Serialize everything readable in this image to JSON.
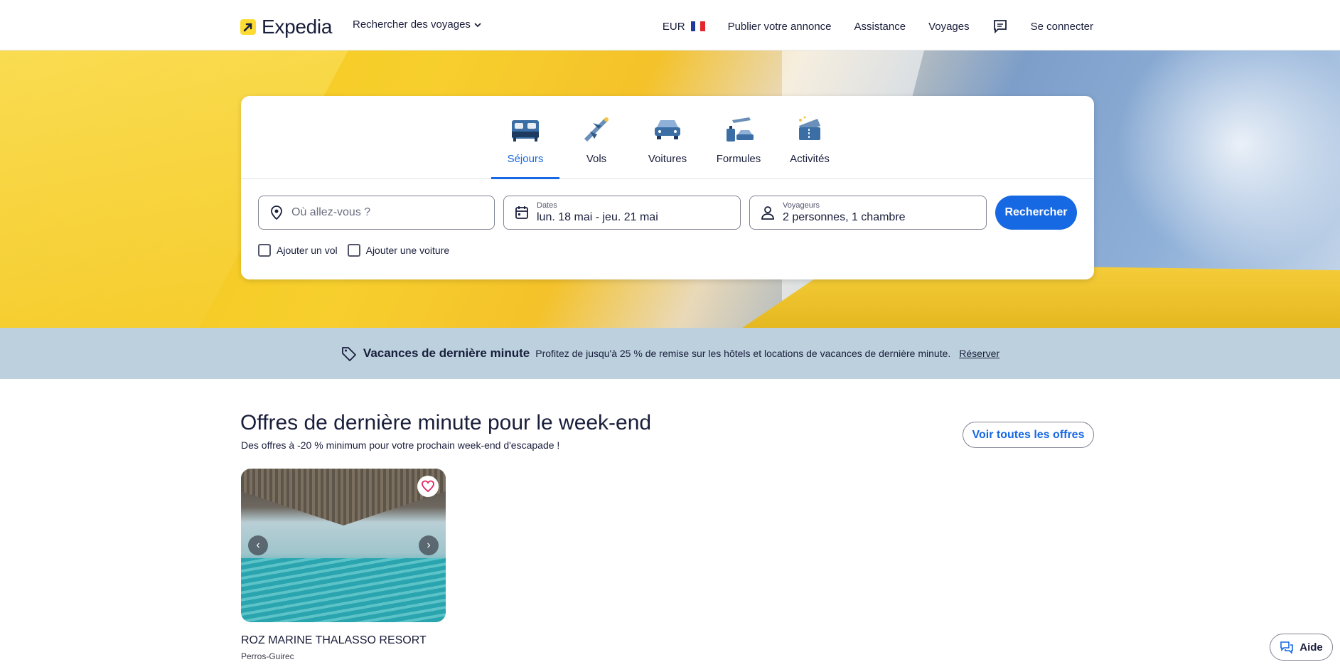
{
  "header": {
    "logo_text": "Expedia",
    "search_trips": "Rechercher des voyages",
    "currency": "EUR",
    "publish": "Publier votre annonce",
    "support": "Assistance",
    "trips": "Voyages",
    "sign_in": "Se connecter"
  },
  "tabs": [
    {
      "label": "Séjours",
      "icon": "bed-icon",
      "active": true
    },
    {
      "label": "Vols",
      "icon": "plane-icon"
    },
    {
      "label": "Voitures",
      "icon": "car-icon"
    },
    {
      "label": "Formules",
      "icon": "package-icon"
    },
    {
      "label": "Activités",
      "icon": "ticket-icon"
    }
  ],
  "search": {
    "destination_placeholder": "Où allez-vous ?",
    "dates_label": "Dates",
    "dates_value": "lun. 18 mai - jeu. 21 mai",
    "travelers_label": "Voyageurs",
    "travelers_value": "2 personnes, 1 chambre",
    "button": "Rechercher",
    "add_flight": "Ajouter un vol",
    "add_car": "Ajouter une voiture"
  },
  "promo": {
    "title": "Vacances de dernière minute",
    "text": "Profitez de jusqu'à 25 % de remise sur les hôtels et locations de vacances de dernière minute.",
    "link": "Réserver"
  },
  "offers": {
    "title": "Offres de dernière minute pour le week-end",
    "subtitle": "Des offres à -20 % minimum pour votre prochain week-end d'escapade !",
    "see_all": "Voir toutes les offres"
  },
  "hotel": {
    "name": "ROZ MARINE THALASSO RESORT",
    "city": "Perros-Guirec"
  },
  "help": {
    "label": "Aide"
  },
  "colors": {
    "accent": "#1668e3",
    "promo_bg": "#bcd0de",
    "brand_yellow": "#fddb32"
  }
}
